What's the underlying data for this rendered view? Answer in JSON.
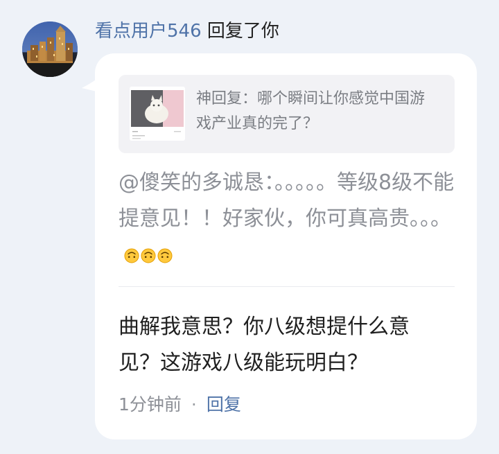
{
  "header": {
    "username": "看点用户546",
    "action": "回复了你"
  },
  "quote": {
    "text": "神回复：哪个瞬间让你感觉中国游戏产业真的完了？"
  },
  "quoted_comment": {
    "text": "@傻笑的多诚恳：。。。。。等级8级不能提意见！！好家伙，你可真高贵。。。",
    "emoji_icons": [
      "upside-down-face-icon",
      "upside-down-face-icon",
      "upside-down-face-icon"
    ]
  },
  "reply": {
    "text": "曲解我意思？你八级想提什么意见？这游戏八级能玩明白？"
  },
  "meta": {
    "time": "1分钟前",
    "separator": "·",
    "reply_label": "回复"
  },
  "colors": {
    "background": "#eef2f8",
    "bubble": "#ffffff",
    "quote_background": "#f2f2f5",
    "username": "#4f73a8",
    "muted_text": "#8d9097",
    "main_text": "#1f1f1f"
  }
}
